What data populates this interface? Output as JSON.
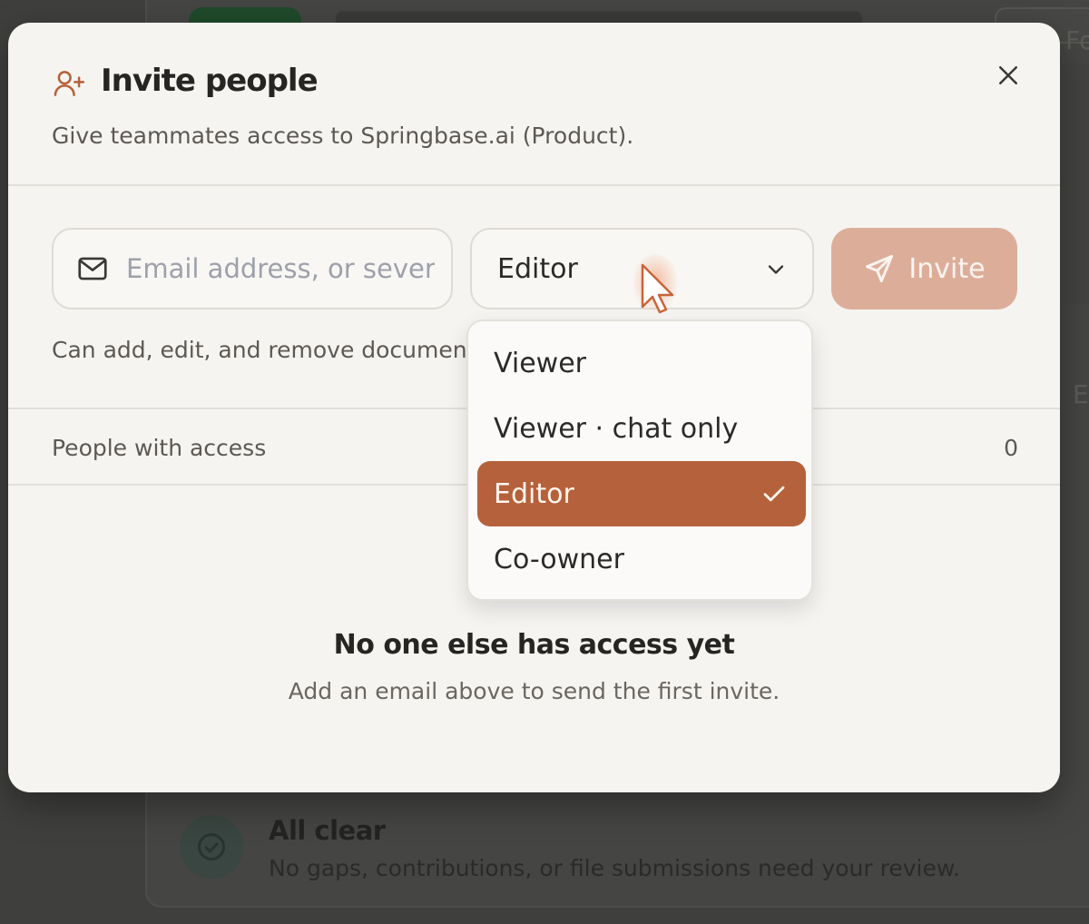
{
  "background": {
    "fragment_top_right": "Fo",
    "fragment_right": "E",
    "all_clear_title": "All clear",
    "all_clear_desc": "No gaps, contributions, or file submissions need your review."
  },
  "modal": {
    "title": "Invite people",
    "subtitle": "Give teammates access to Springbase.ai (Product).",
    "email_placeholder": "Email address, or several separated by commas",
    "role_selected": "Editor",
    "invite_label": "Invite",
    "role_description": "Can add, edit, and remove documents",
    "people_label": "People with access",
    "people_count": "0",
    "empty_title": "No one else has access yet",
    "empty_subtitle": "Add an email above to send the first invite."
  },
  "dropdown": {
    "options": [
      {
        "label": "Viewer"
      },
      {
        "label": "Viewer · chat only"
      },
      {
        "label": "Editor"
      },
      {
        "label": "Co-owner"
      }
    ]
  },
  "colors": {
    "accent": "#b5613b",
    "invite_button_disabled": "#dcae9a",
    "modal_bg": "#f6f4f1"
  },
  "icons": {
    "header": "user-plus-icon",
    "close": "close-icon",
    "email": "mail-icon",
    "select": "chevron-down-icon",
    "invite": "send-icon",
    "selected": "check-icon"
  }
}
